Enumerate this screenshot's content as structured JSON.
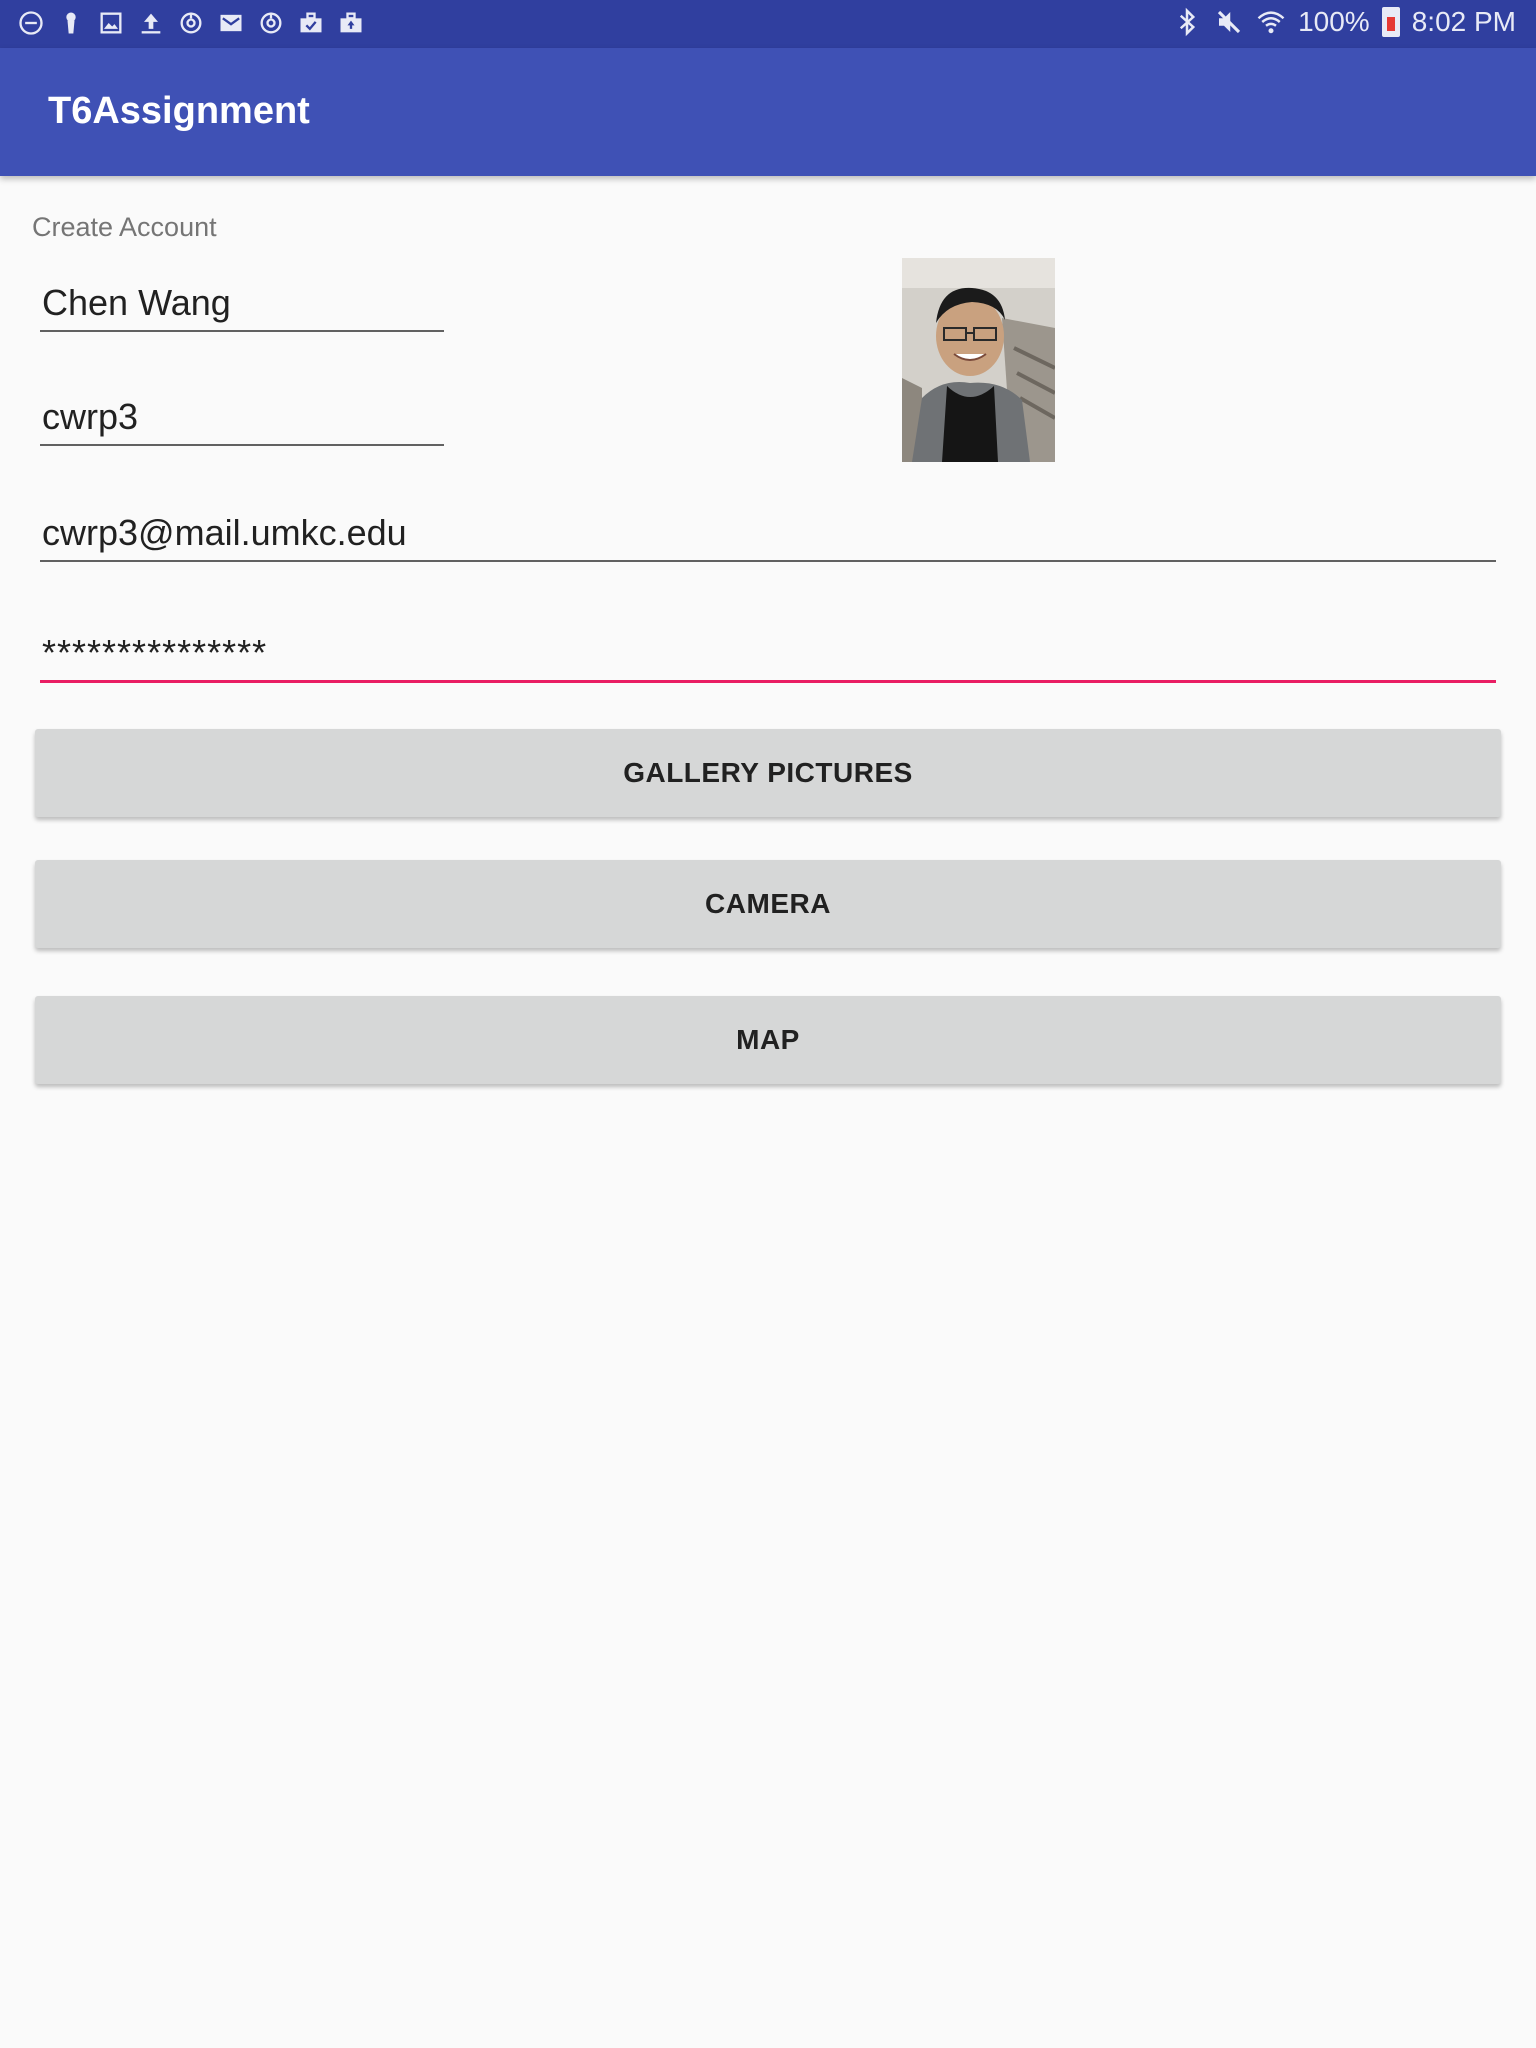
{
  "status_bar": {
    "left_icons": [
      "do-not-disturb-icon",
      "keyhole-icon",
      "image-icon",
      "upload-icon",
      "sync-icon",
      "mail-icon",
      "sync-icon",
      "briefcase-check-icon",
      "briefcase-upload-icon"
    ],
    "right_icons": [
      "bluetooth-icon",
      "mute-icon",
      "wifi-icon"
    ],
    "battery_text": "100%",
    "time": "8:02 PM"
  },
  "app_bar": {
    "title": "T6Assignment"
  },
  "form": {
    "section_label": "Create Account",
    "name_value": "Chen Wang",
    "username_value": "cwrp3",
    "email_value": "cwrp3@mail.umkc.edu",
    "password_value": "***************"
  },
  "buttons": {
    "gallery": "GALLERY PICTURES",
    "camera": "CAMERA",
    "map": "MAP"
  },
  "colors": {
    "status_bar": "#303f9f",
    "app_bar": "#3f51b5",
    "accent": "#e91e63",
    "button_bg": "#d6d7d7"
  }
}
